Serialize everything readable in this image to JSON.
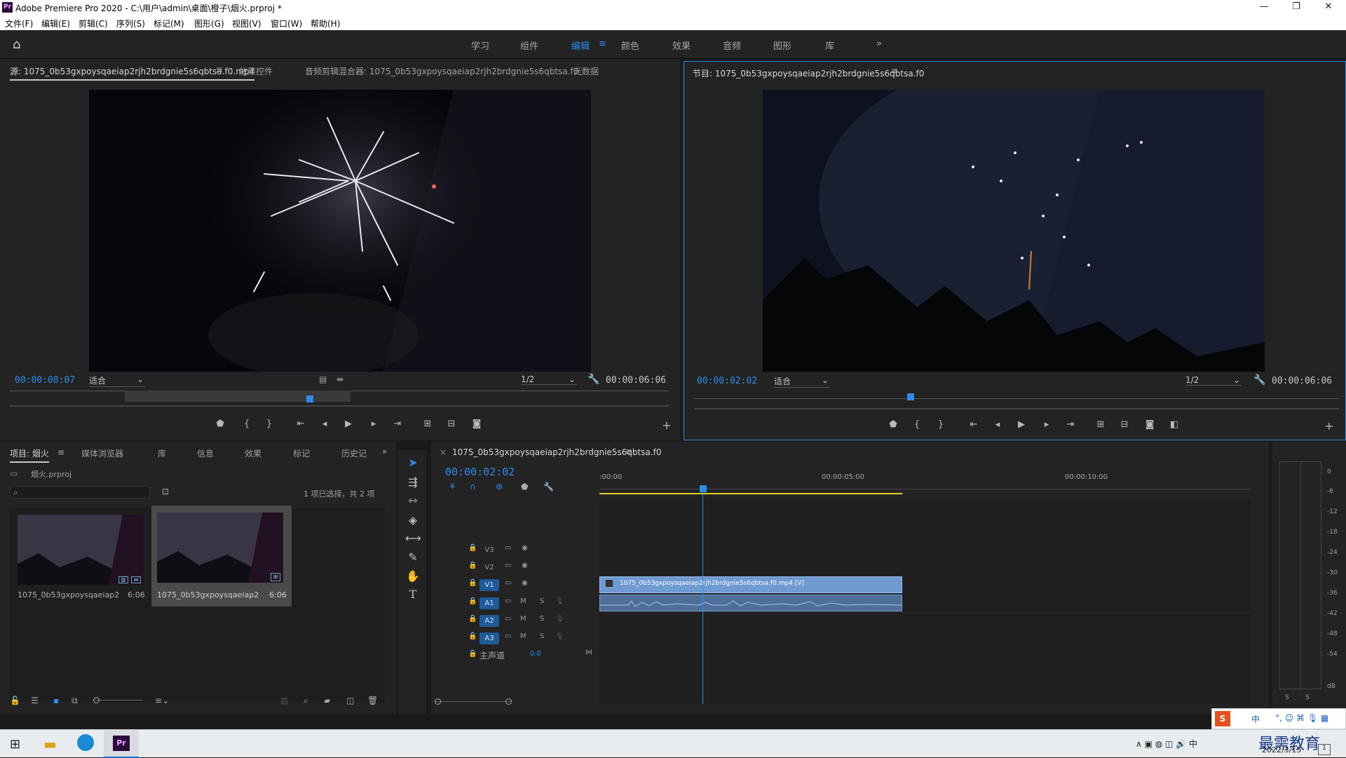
{
  "window": {
    "title": "Adobe Premiere Pro 2020 - C:\\用户\\admin\\桌面\\橙子\\烟火.prproj *",
    "app_icon": "Pr",
    "minimize": "—",
    "restore": "❐",
    "close": "✕"
  },
  "menu": [
    "文件(F)",
    "编辑(E)",
    "剪辑(C)",
    "序列(S)",
    "标记(M)",
    "图形(G)",
    "视图(V)",
    "窗口(W)",
    "帮助(H)"
  ],
  "workspaces": {
    "items": [
      "学习",
      "组件",
      "编辑",
      "颜色",
      "效果",
      "音频",
      "图形",
      "库"
    ],
    "active": "编辑",
    "more": "»"
  },
  "source_panel": {
    "tabs": [
      "源: 1075_0b53gxpoysqaeiap2rjh2brdgnie5s6qbtsa.f0.mp4",
      "效果控件",
      "音频剪辑混合器: 1075_0b53gxpoysqaeiap2rjh2brdgnie5s6qbtsa.f0",
      "元数据"
    ],
    "timecode": "00:00:08:07",
    "fit": "适合",
    "resolution": "1/2",
    "duration": "00:00:06:06"
  },
  "program_panel": {
    "tab": "节目: 1075_0b53gxpoysqaeiap2rjh2brdgnie5s6qbtsa.f0",
    "timecode": "00:00:02:02",
    "fit": "适合",
    "resolution": "1/2",
    "duration": "00:00:06:06",
    "playhead_fraction": 0.33
  },
  "project_panel": {
    "tabs": [
      "项目: 烟火",
      "媒体浏览器",
      "库",
      "信息",
      "效果",
      "标记",
      "历史记"
    ],
    "project_file": "烟火.prproj",
    "selection_info": "1 项已选择，共 2 项",
    "items": [
      {
        "name": "1075_0b53gxpoysqaeiap2rjh...",
        "duration": "6:06"
      },
      {
        "name": "1075_0b53gxpoysqaeiap2rjh...",
        "duration": "6:06"
      }
    ]
  },
  "timeline": {
    "tab": "1075_0b53gxpoysqaeiap2rjh2brdgnie5s6qbtsa.f0",
    "timecode": "00:00:02:02",
    "ruler": [
      ":00:00",
      "00:00:05:00",
      "00:00:10:00"
    ],
    "tracks": [
      {
        "name": "V3",
        "type": "video"
      },
      {
        "name": "V2",
        "type": "video"
      },
      {
        "name": "V1",
        "type": "video",
        "targeted": true
      },
      {
        "name": "A1",
        "type": "audio",
        "targeted": true
      },
      {
        "name": "A2",
        "type": "audio",
        "targeted": true
      },
      {
        "name": "A3",
        "type": "audio",
        "targeted": true
      }
    ],
    "master": {
      "label": "主声道",
      "value": "0.0"
    },
    "clip_video_label": "1075_0b53gxpoysqaeiap2rjh2brdgnie5s6qbtsa.f0.mp4 [V]",
    "m": "M",
    "s": "S"
  },
  "audio_meter": {
    "scale": [
      "0",
      "-6",
      "-12",
      "-18",
      "-24",
      "-30",
      "-36",
      "-42",
      "-48",
      "-54",
      "dB"
    ],
    "solo": [
      "S",
      "S"
    ]
  },
  "taskbar": {
    "time": "",
    "date": "2022/3/15",
    "ime": "中",
    "watermark": "最需教育"
  }
}
